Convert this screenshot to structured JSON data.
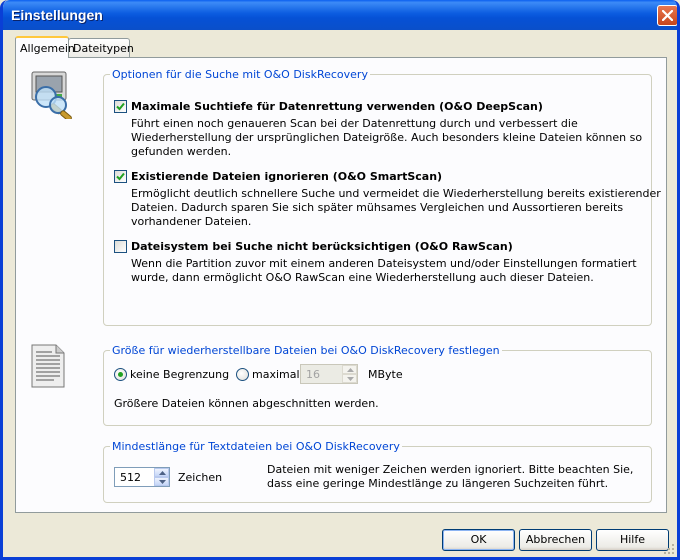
{
  "window": {
    "title": "Einstellungen"
  },
  "tabs": [
    {
      "label": "Allgemein",
      "active": true
    },
    {
      "label": "Dateitypen",
      "active": false
    }
  ],
  "search_options": {
    "group_title": "Optionen für die Suche mit O&O DiskRecovery",
    "icon": "disk-search-icon",
    "options": [
      {
        "label": "Maximale Suchtiefe für Datenrettung verwenden (O&O DeepScan)",
        "checked": true,
        "description": "Führt einen noch genaueren Scan bei der Datenrettung durch und verbessert die Wiederherstellung der ursprünglichen Dateigröße. Auch besonders kleine Dateien können so gefunden werden."
      },
      {
        "label": "Existierende Dateien ignorieren (O&O SmartScan)",
        "checked": true,
        "description": "Ermöglicht deutlich schnellere Suche und vermeidet die Wiederherstellung bereits existierender Dateien. Dadurch sparen Sie sich später mühsames Vergleichen und Aussortieren bereits vorhandener Dateien."
      },
      {
        "label": "Dateisystem bei Suche nicht berücksichtigen (O&O RawScan)",
        "checked": false,
        "description": "Wenn die Partition zuvor mit einem anderen Dateisystem und/oder Einstellungen formatiert wurde, dann ermöglicht O&O RawScan eine Wiederherstellung auch dieser Dateien."
      }
    ]
  },
  "file_size": {
    "group_title": "Größe für wiederherstellbare Dateien bei O&O DiskRecovery festlegen",
    "icon": "document-icon",
    "option_unlimited": "keine Begrenzung",
    "option_maximum": "maximal",
    "selected": "keine Begrenzung",
    "max_value": "16",
    "unit": "MByte",
    "note": "Größere Dateien können abgeschnitten werden."
  },
  "min_length": {
    "group_title": "Mindestlänge für Textdateien bei O&O DiskRecovery",
    "value": "512",
    "unit": "Zeichen",
    "note": "Dateien mit weniger Zeichen werden ignoriert. Bitte beachten Sie, dass eine geringe Mindestlänge zu längeren Suchzeiten führt."
  },
  "buttons": {
    "ok": "OK",
    "cancel": "Abbrechen",
    "help": "Hilfe"
  },
  "colors": {
    "group_title": "#0046d5",
    "titlebar": "#0b5ce0",
    "check": "#21a121"
  }
}
